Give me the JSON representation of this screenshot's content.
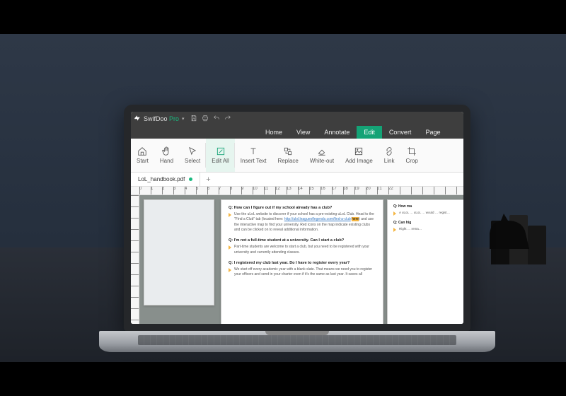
{
  "brand": {
    "name1": "SwifDoo",
    "name2": "Pro"
  },
  "menu": {
    "home": "Home",
    "view": "View",
    "annotate": "Annotate",
    "edit": "Edit",
    "convert": "Convert",
    "page": "Page"
  },
  "ribbon": {
    "start": "Start",
    "hand": "Hand",
    "select": "Select",
    "editall": "Edit All",
    "inserttext": "Insert Text",
    "replace": "Replace",
    "whiteout": "White-out",
    "addimage": "Add Image",
    "link": "Link",
    "crop": "Crop"
  },
  "tab": {
    "filename": "LoL_handbook.pdf",
    "add": "+"
  },
  "ruler": [
    "0",
    "1",
    "2",
    "3",
    "4",
    "5",
    "6",
    "7",
    "8",
    "9",
    "10",
    "11",
    "12",
    "13",
    "14",
    "15",
    "16",
    "17",
    "18",
    "19",
    "20",
    "21",
    "22"
  ],
  "content": {
    "q1": {
      "q": "Q: How can I figure out if my school already has a club?",
      "a_pre": "Use the uLoL website to discover if your school has a pre-existing uLoL Club. Head to the \"Find a Club\" tab (located here: ",
      "a_link": "http://ulol.leagueoflegends.com/find-a-club",
      "a_hl": "here",
      "a_post": ") and use the interactive map to find your university. Red icons on the map indicate existing clubs and can be clicked on to reveal additional information."
    },
    "q2": {
      "q": "Q: I'm not a full-time student at a university. Can I start a club?",
      "a": "Part-time students are welcome to start a club, but you need to be registered with your university and currently attending classes."
    },
    "q3": {
      "q": "Q: I registered my club last year. Do I have to register every year?",
      "a": "We start off every academic year with a blank slate. That means we need you to register your officers and send in your charter even if it's the same as last year. It saves all"
    },
    "s1": {
      "q": "Q: How ma",
      "a": "A uLoL … uLoL … would … regist…"
    },
    "s2": {
      "q": "Q: Can hig",
      "a": "Right … rema…"
    }
  }
}
